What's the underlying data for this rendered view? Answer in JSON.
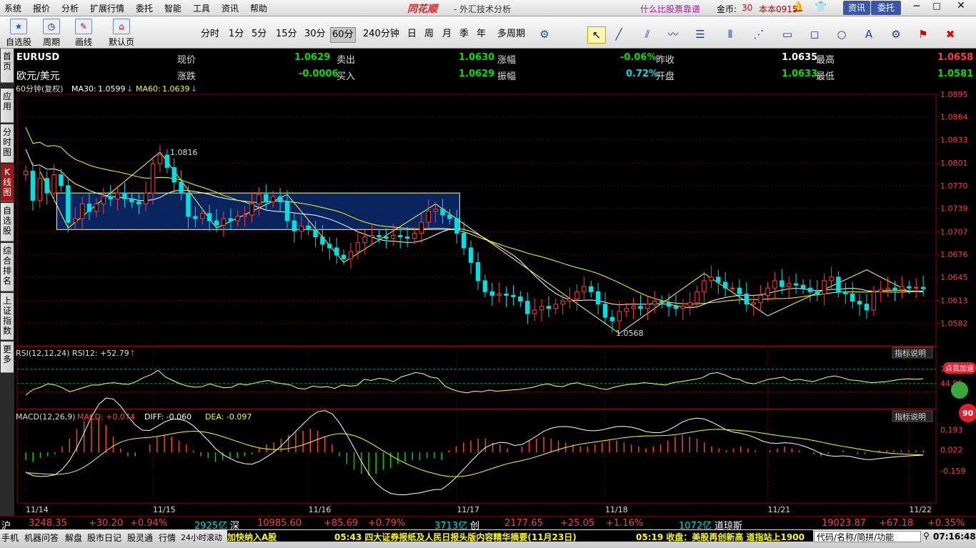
{
  "menu": [
    "系统",
    "报价",
    "分析",
    "扩展行情",
    "委托",
    "智能",
    "工具",
    "资讯",
    "帮助"
  ],
  "brand": "同花顺",
  "subtitle": "- 外汇技术分析",
  "promo": "什么比股票靠谱",
  "coins": {
    "label": "金币:",
    "value": "30"
  },
  "version": "本本0915",
  "topbuttons": {
    "news": "资讯",
    "trade": "委托"
  },
  "toolbar_left": [
    {
      "label": "自选股",
      "icon": "star-icon"
    },
    {
      "label": "周期",
      "icon": "clock-icon"
    },
    {
      "label": "画线",
      "icon": "pencil-icon"
    },
    {
      "label": "默认页",
      "icon": "home-icon"
    }
  ],
  "periods": [
    "分时",
    "1分",
    "5分",
    "15分",
    "30分",
    "60分",
    "240分钟",
    "日",
    "周",
    "月",
    "季",
    "年",
    "多周期"
  ],
  "active_period": "60分",
  "sidetabs": [
    "首页",
    "应用",
    "分时图",
    "K线图",
    "自选股",
    "综合排名",
    "上证指数",
    "更多"
  ],
  "quote": {
    "code": "EURUSD",
    "name": "欧元/美元",
    "row1": [
      {
        "l": "现价",
        "v": "1.0629"
      },
      {
        "l": "卖出",
        "v": "1.0630"
      },
      {
        "l": "涨幅",
        "v": "-0.06%"
      },
      {
        "l": "昨收",
        "v": "1.0635"
      },
      {
        "l": "最高",
        "v": "1.0658"
      }
    ],
    "row2": [
      {
        "l": "涨跌",
        "v": "-0.0006"
      },
      {
        "l": "买入",
        "v": "1.0629"
      },
      {
        "l": "振幅",
        "v": "0.72%"
      },
      {
        "l": "开盘",
        "v": "1.0633"
      },
      {
        "l": "最低",
        "v": "1.0581"
      }
    ]
  },
  "chart_data": {
    "type": "candlestick",
    "header": "60分钟(复权)",
    "ma_labels": [
      {
        "name": "MA30:",
        "value": "1.0599",
        "color": "#ffffff"
      },
      {
        "name": "MA60:",
        "value": "1.0639",
        "color": "#ffff00"
      }
    ],
    "ylim": [
      1.0551,
      1.0895
    ],
    "yticks": [
      "1.0895",
      "1.0864",
      "1.0833",
      "1.0801",
      "1.0770",
      "1.0739",
      "1.0707",
      "1.0676",
      "1.0645",
      "1.0613",
      "1.0582"
    ],
    "xticks": [
      "11/14",
      "11/15",
      "11/16",
      "11/17",
      "11/18",
      "11/21",
      "11/22"
    ],
    "high_label": "1.0816",
    "low_label": "1.0568",
    "rsi_label": "RSI(12,12,24)  RSI12: +52.79",
    "rsi_ticks": [
      "70.00",
      "44.95"
    ],
    "macd_label_prefix": "MACD(12,26,9)",
    "macd_vals": {
      "macd": "MACD: +0.074",
      "diff": "DIFF: -0.060",
      "dea": "DEA: -0.097"
    },
    "macd_ticks": [
      "0.193",
      "0.022",
      "-0.159"
    ],
    "indicator_help": "指标说明",
    "closes": [
      1.079,
      1.075,
      1.078,
      1.076,
      1.0785,
      1.077,
      1.072,
      1.0725,
      1.0745,
      1.0735,
      1.0745,
      1.0755,
      1.0752,
      1.076,
      1.0752,
      1.0748,
      1.0745,
      1.076,
      1.08,
      1.0812,
      1.0795,
      1.0775,
      1.076,
      1.0728,
      1.0725,
      1.0732,
      1.0722,
      1.0716,
      1.0725,
      1.0722,
      1.0728,
      1.073,
      1.0745,
      1.0758,
      1.0748,
      1.0755,
      1.0748,
      1.0722,
      1.0708,
      1.0715,
      1.071,
      1.07,
      1.069,
      1.0685,
      1.0675,
      1.067,
      1.068,
      1.0692,
      1.07,
      1.0702,
      1.07,
      1.0698,
      1.0702,
      1.07,
      1.0698,
      1.0705,
      1.072,
      1.0735,
      1.0738,
      1.073,
      1.0725,
      1.0705,
      1.0685,
      1.0665,
      1.064,
      1.0625,
      1.062,
      1.0622,
      1.062,
      1.0618,
      1.0612,
      1.0595,
      1.06,
      1.0605,
      1.0602,
      1.0608,
      1.0612,
      1.0615,
      1.0625,
      1.0632,
      1.0625,
      1.0608,
      1.059,
      1.0585,
      1.0598,
      1.0602,
      1.0605,
      1.0602,
      1.0608,
      1.0612,
      1.061,
      1.0605,
      1.0602,
      1.0605,
      1.061,
      1.0625,
      1.064,
      1.0645,
      1.0638,
      1.063,
      1.063,
      1.0622,
      1.0608,
      1.061,
      1.062,
      1.063,
      1.064,
      1.0632,
      1.0636,
      1.0634,
      1.063,
      1.0625,
      1.0622,
      1.064,
      1.0645,
      1.0625,
      1.0622,
      1.0612,
      1.0608,
      1.06,
      1.0625,
      1.0628,
      1.063,
      1.0628,
      1.0632,
      1.063,
      1.0631,
      1.0629
    ],
    "rsi_series": [
      24,
      34,
      38,
      44,
      42,
      37,
      30,
      34,
      38,
      42,
      42,
      45,
      46,
      44,
      43,
      48,
      55,
      60,
      68,
      56,
      50,
      44,
      40,
      38,
      39,
      44,
      40,
      37,
      38,
      44,
      42,
      45,
      48,
      50,
      46,
      44,
      42,
      36,
      35,
      40,
      38,
      39,
      36,
      42,
      40,
      41,
      52,
      50,
      54,
      52,
      48,
      56,
      60,
      64,
      62,
      56,
      54,
      40,
      34,
      30,
      28,
      31,
      30,
      33,
      31,
      32,
      33,
      34,
      36,
      38,
      42,
      44,
      40,
      39,
      44,
      46,
      42,
      40,
      36,
      34,
      38,
      41,
      43,
      44,
      46,
      45,
      43,
      42,
      46,
      48,
      50,
      52,
      55,
      62,
      64,
      60,
      54,
      52,
      46,
      44,
      48,
      52,
      54,
      56,
      50,
      52,
      50,
      48,
      52,
      56,
      58,
      55,
      51,
      50,
      48,
      46,
      47,
      48,
      50,
      52,
      53,
      52,
      53
    ],
    "macd_hist": [
      -0.04,
      -0.05,
      -0.03,
      -0.02,
      -0.01,
      0.03,
      0.07,
      0.12,
      0.16,
      0.19,
      0.18,
      0.14,
      0.08,
      0.02,
      -0.02,
      -0.02,
      0.0,
      0.04,
      0.08,
      0.09,
      0.08,
      0.06,
      0.04,
      0.01,
      -0.02,
      -0.03,
      -0.05,
      -0.04,
      -0.03,
      -0.03,
      -0.02,
      -0.01,
      0.02,
      0.04,
      0.05,
      0.07,
      0.09,
      0.1,
      0.11,
      0.12,
      0.11,
      0.08,
      0.04,
      -0.02,
      -0.06,
      -0.09,
      -0.11,
      -0.12,
      -0.11,
      -0.09,
      -0.08,
      -0.06,
      -0.05,
      -0.04,
      -0.04,
      -0.03,
      -0.03,
      -0.04,
      0.01,
      0.03,
      0.05,
      0.06,
      0.07,
      0.07,
      0.05,
      0.04,
      0.02,
      0.0,
      0.03,
      0.06,
      0.07,
      0.08,
      0.07,
      0.06,
      0.05,
      0.04,
      0.03,
      0.03,
      0.04,
      0.05,
      0.06,
      0.06,
      0.05,
      0.04,
      0.03,
      0.02,
      0.03,
      0.04,
      0.06,
      0.08,
      0.09,
      0.08,
      0.07,
      0.05,
      0.03,
      0.02,
      0.01,
      0.02,
      0.03,
      0.02,
      0.01,
      0.0,
      0.01,
      0.02,
      0.03,
      0.02,
      0.01,
      0.0,
      -0.01,
      -0.02,
      -0.01,
      0.0,
      0.01,
      0.0,
      -0.01,
      -0.01,
      0.0,
      0.01,
      0.01,
      0.01,
      0.01,
      0.01,
      0.01,
      0.01
    ]
  },
  "statusbar": [
    {
      "t": "沪",
      "c": "#ffffff"
    },
    {
      "t": "3248.35",
      "c": "#ff3c3c"
    },
    {
      "t": "+30.20",
      "c": "#ff3c3c"
    },
    {
      "t": "+0.94%",
      "c": "#ff3c3c"
    },
    {
      "t": "2925亿",
      "c": "#00dcdc"
    },
    {
      "t": "深",
      "c": "#ffffff"
    },
    {
      "t": "10985.60",
      "c": "#ff3c3c"
    },
    {
      "t": "+85.69",
      "c": "#ff3c3c"
    },
    {
      "t": "+0.79%",
      "c": "#ff3c3c"
    },
    {
      "t": "3713亿",
      "c": "#00dcdc"
    },
    {
      "t": "创",
      "c": "#ffffff"
    },
    {
      "t": "2177.65",
      "c": "#ff3c3c"
    },
    {
      "t": "+25.05",
      "c": "#ff3c3c"
    },
    {
      "t": "+1.16%",
      "c": "#ff3c3c"
    },
    {
      "t": "1072亿",
      "c": "#00dcdc"
    },
    {
      "t": "道琼斯",
      "c": "#ffffff"
    },
    {
      "t": "19023.87",
      "c": "#ff3c3c"
    },
    {
      "t": "+67.18",
      "c": "#ff3c3c"
    },
    {
      "t": "+0.35%",
      "c": "#ff3c3c"
    }
  ],
  "taskbar": [
    "手机",
    "机器问答",
    "解盘",
    "股市日记",
    "股灵通",
    "行情",
    "24小时滚动"
  ],
  "ticker": [
    {
      "t": "加快纳入A股",
      "c": "#ffff00"
    },
    {
      "t": "05:43  四大证券报纸及人民日报头版内容精华摘要(11月23日)",
      "c": "#ffff00"
    },
    {
      "t": "05:19  收盘：美股再创新高 道指站上1900",
      "c": "#ffff00"
    }
  ],
  "search_placeholder": "代码/名称/简拼/功能",
  "clock": "07:16:48",
  "badge": {
    "text": "点我加速",
    "value": "90"
  }
}
